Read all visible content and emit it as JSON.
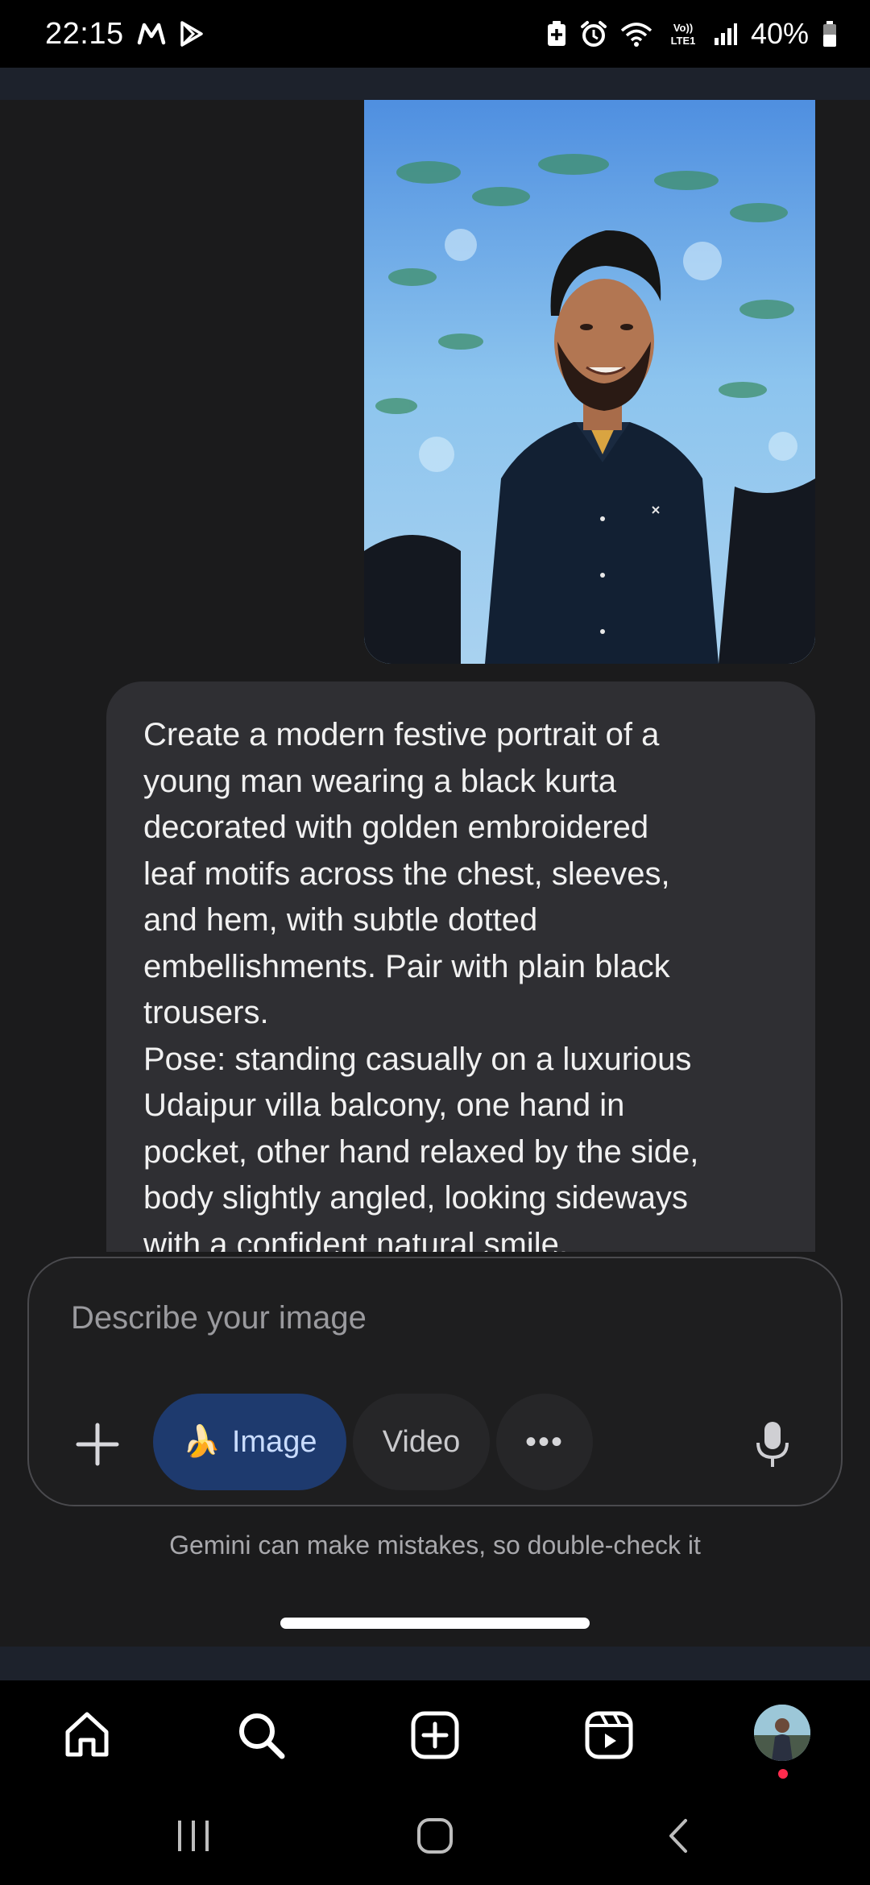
{
  "status_bar": {
    "time": "22:15",
    "battery": "40%",
    "network_label": "Vo)) LTE1",
    "icons": [
      "messages-m-icon",
      "play-store-icon",
      "battery-saver-icon",
      "alarm-icon",
      "wifi-icon",
      "signal-icon",
      "battery-icon"
    ]
  },
  "chat": {
    "photo_alt": "Photo of a smiling young man in a dark shirt",
    "message": "Create a modern festive portrait of a\nyoung man wearing a black kurta\ndecorated with golden embroidered\nleaf motifs across the chest, sleeves,\nand hem, with subtle dotted\nembellishments. Pair with plain black\ntrousers.\nPose: standing casually on a luxurious\nUdaipur villa balcony, one hand in\npocket, other hand relaxed by the side,\nbody slightly angled, looking sideways\nwith a confident natural smile."
  },
  "composer": {
    "placeholder": "Describe your image",
    "value": "",
    "image_chip_label": "Image",
    "image_chip_emoji": "🍌",
    "video_chip_label": "Video",
    "more_label": "•••"
  },
  "disclaimer": "Gemini can make mistakes, so double-check it",
  "app_nav": {
    "items": [
      "home-icon",
      "search-icon",
      "create-icon",
      "reels-icon",
      "profile-avatar"
    ]
  },
  "system_nav": {
    "items": [
      "recents-icon",
      "home-button-icon",
      "back-icon"
    ]
  },
  "colors": {
    "background": "#1b1b1c",
    "bubble": "#2f2f33",
    "image_chip": "#1e3a6e",
    "accent_text": "#c9dcff",
    "notification_dot": "#ff2b4d"
  }
}
